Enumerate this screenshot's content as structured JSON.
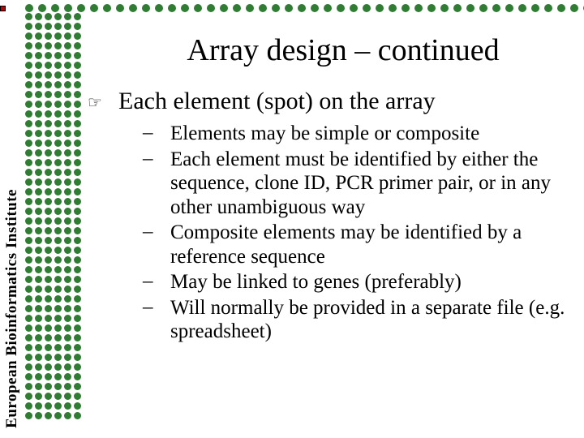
{
  "brand_vertical": "European Bioinformatics Institute",
  "title": "Array design – continued",
  "main": {
    "bullet_glyph": "☞",
    "text": "Each element (spot) on the array"
  },
  "sub_bullet_glyph": "–",
  "sub_items": [
    "Elements may be simple or composite",
    "Each element must be identified by either the sequence, clone ID, PCR primer pair, or in any other unambiguous way",
    "Composite elements may be identified by a reference sequence",
    "May be linked to genes (preferably)",
    "Will normally be provided in a separate file (e.g. spreadsheet)"
  ],
  "colors": {
    "green": "#2e7d32",
    "red": "#c00000"
  },
  "decoration": {
    "h_dot_count": 45,
    "v_col_rows": 42,
    "v_cols": 6
  }
}
